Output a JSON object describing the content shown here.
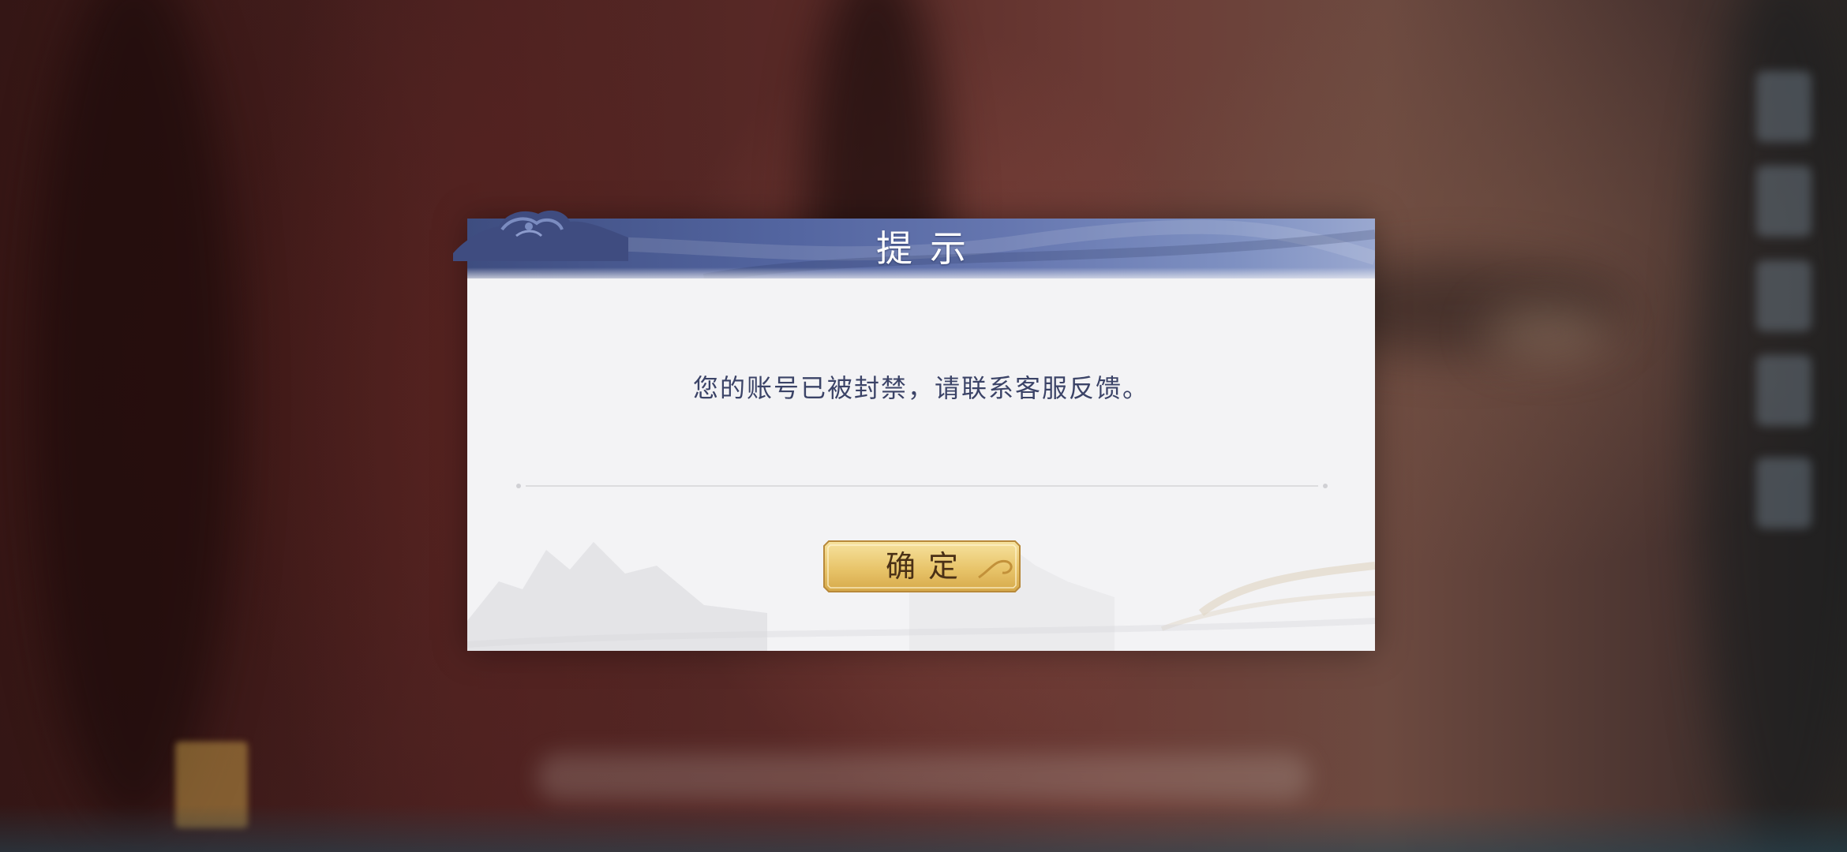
{
  "dialog": {
    "title": "提示",
    "message": "您的账号已被封禁，请联系客服反馈。",
    "confirm_label": "确定"
  },
  "icons": {
    "header_ornament": "cloud-ornament-icon",
    "button_flourish": "swirl-flourish-icon"
  },
  "colors": {
    "header": "#5365a0",
    "message_text": "#3b4367",
    "button_gold": "#e8c46a",
    "button_text": "#4a3016",
    "dialog_body": "#f3f3f5"
  }
}
